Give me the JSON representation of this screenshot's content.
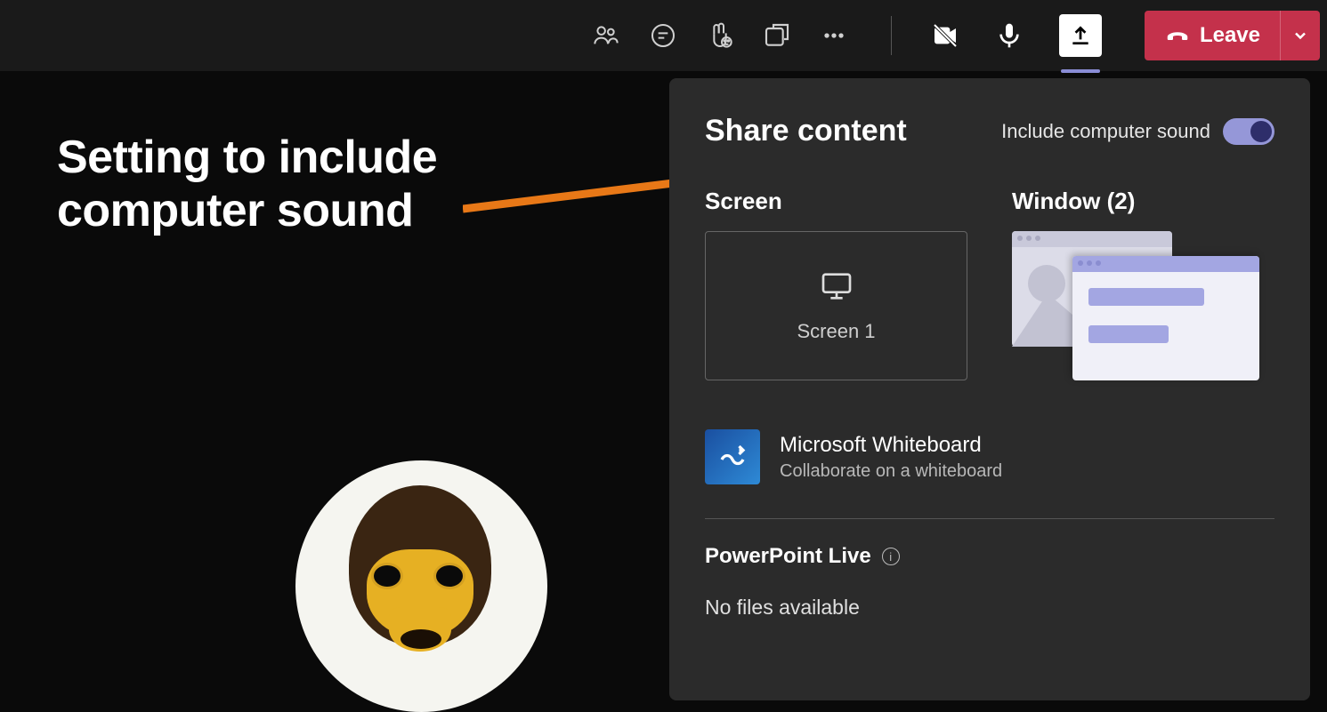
{
  "topbar": {
    "leave_label": "Leave"
  },
  "annotation": {
    "line1": "Setting to include",
    "line2": "computer sound"
  },
  "panel": {
    "title": "Share content",
    "toggle_label": "Include computer sound",
    "screen_section": "Screen",
    "screen_tile": "Screen 1",
    "window_section": "Window (2)",
    "whiteboard": {
      "title": "Microsoft Whiteboard",
      "subtitle": "Collaborate on a whiteboard"
    },
    "powerpoint_label": "PowerPoint Live",
    "no_files": "No files available"
  }
}
